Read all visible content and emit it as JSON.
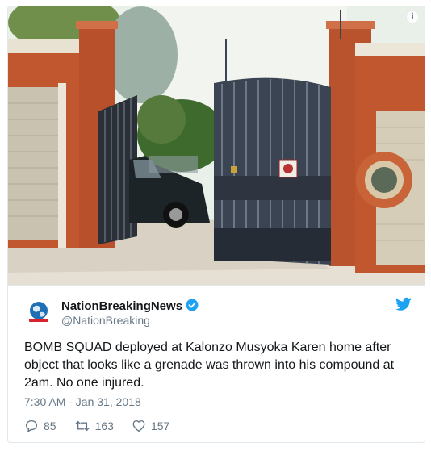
{
  "media": {
    "alt_icon": "info-circle-icon",
    "info_glyph": "i"
  },
  "tweet": {
    "display_name": "NationBreakingNews",
    "handle": "@NationBreaking",
    "verified_icon": "verified-badge-icon",
    "avatar_icon": "globe-logo-icon",
    "platform_icon": "twitter-bird-icon",
    "text": "BOMB SQUAD deployed at Kalonzo Musyoka Karen home after object that looks like a grenade was thrown into his compound at 2am. No one injured.",
    "timestamp": "7:30 AM - Jan 31, 2018"
  },
  "actions": {
    "replies": "85",
    "retweets": "163",
    "likes": "157"
  },
  "colors": {
    "accent": "#1da1f2",
    "text": "#14171a",
    "muted": "#657786",
    "border": "#e1e8ed"
  }
}
